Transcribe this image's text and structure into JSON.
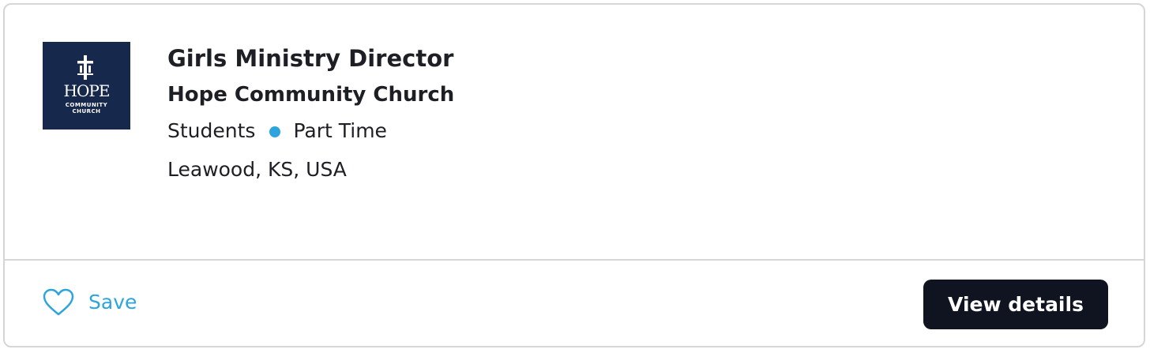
{
  "job": {
    "title": "Girls Ministry Director",
    "organization": "Hope Community Church",
    "category": "Students",
    "employment_type": "Part Time",
    "location": "Leawood, KS, USA"
  },
  "logo": {
    "word": "HOPE",
    "line1": "COMMUNITY",
    "line2": "CHURCH",
    "background": "#16284b",
    "icon": "cross-icon"
  },
  "actions": {
    "save_label": "Save",
    "save_icon": "heart-icon",
    "view_details_label": "View details"
  },
  "colors": {
    "accent": "#2da4de",
    "button_bg": "#0f1420",
    "text": "#1d1f24",
    "border": "#d4d6da"
  }
}
